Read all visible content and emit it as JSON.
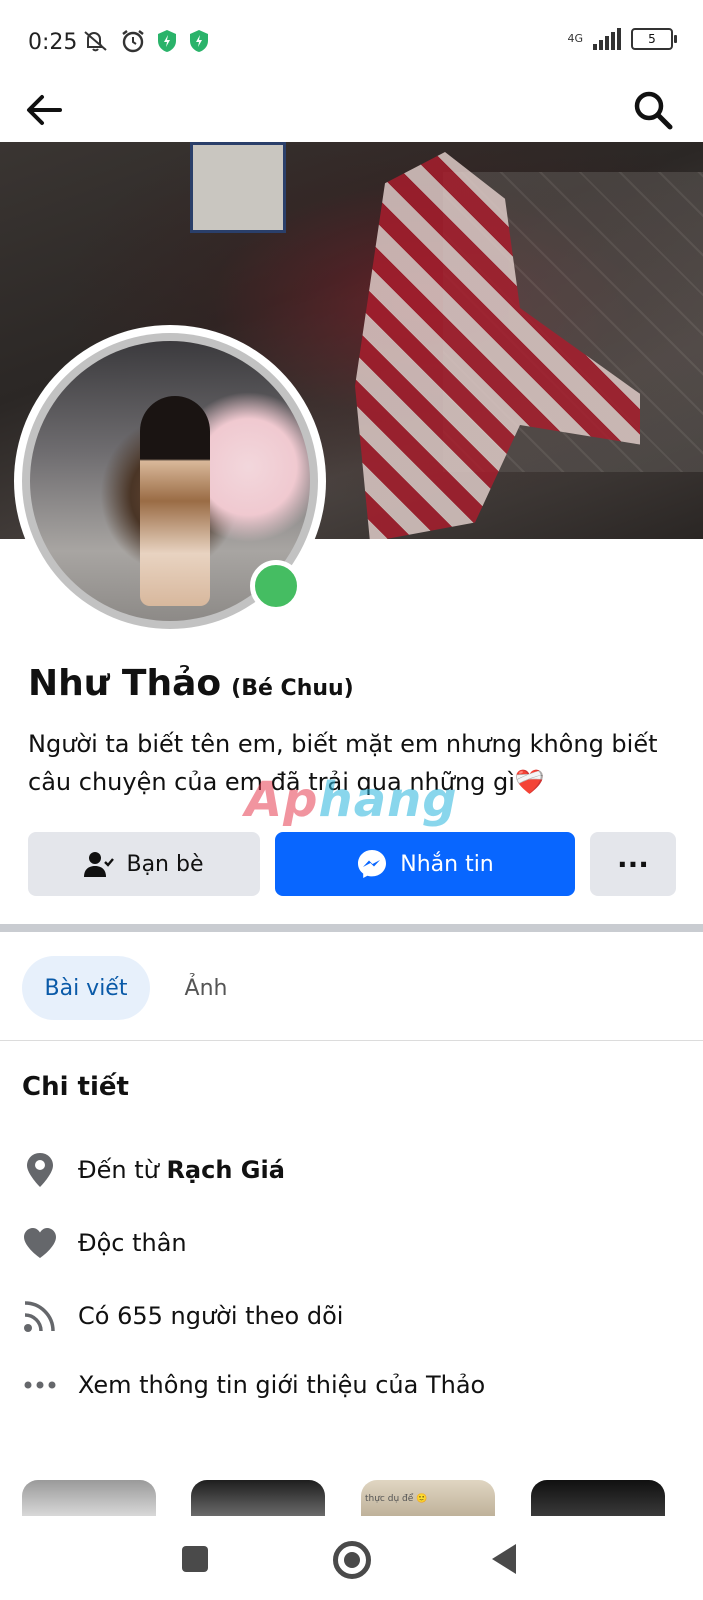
{
  "status_bar": {
    "time": "0:25",
    "network": "4G",
    "battery": "5",
    "icons": [
      "mute-icon",
      "alarm-icon",
      "shield-icon",
      "shield-icon"
    ]
  },
  "nav": {
    "back_icon": "arrow-left-icon",
    "search_icon": "search-icon"
  },
  "profile": {
    "name": "Như Thảo",
    "alt_name": "(Bé Chuu)",
    "bio": "Người ta biết tên em, biết mặt em nhưng không biết câu chuyện của em đã trải qua những gì❤️‍🩹",
    "online": true
  },
  "watermark": {
    "part1": "Ap",
    "part2": "hang"
  },
  "actions": {
    "friends_label": "Bạn bè",
    "message_label": "Nhắn tin",
    "more_label": "···"
  },
  "tabs": [
    {
      "label": "Bài viết",
      "active": true
    },
    {
      "label": "Ảnh",
      "active": false
    }
  ],
  "details": {
    "title": "Chi tiết",
    "from_prefix": "Đến từ ",
    "from_place": "Rạch Giá",
    "relationship": "Độc thân",
    "followers": "Có 655 người theo dõi",
    "see_about": "Xem thông tin giới thiệu của Thảo"
  },
  "thumbnail_caption": "thực dụ để 🙂",
  "colors": {
    "accent": "#0866ff",
    "online": "#45bd62",
    "tab_active_bg": "#e7f0fb",
    "tab_active_text": "#0a5aa8"
  }
}
